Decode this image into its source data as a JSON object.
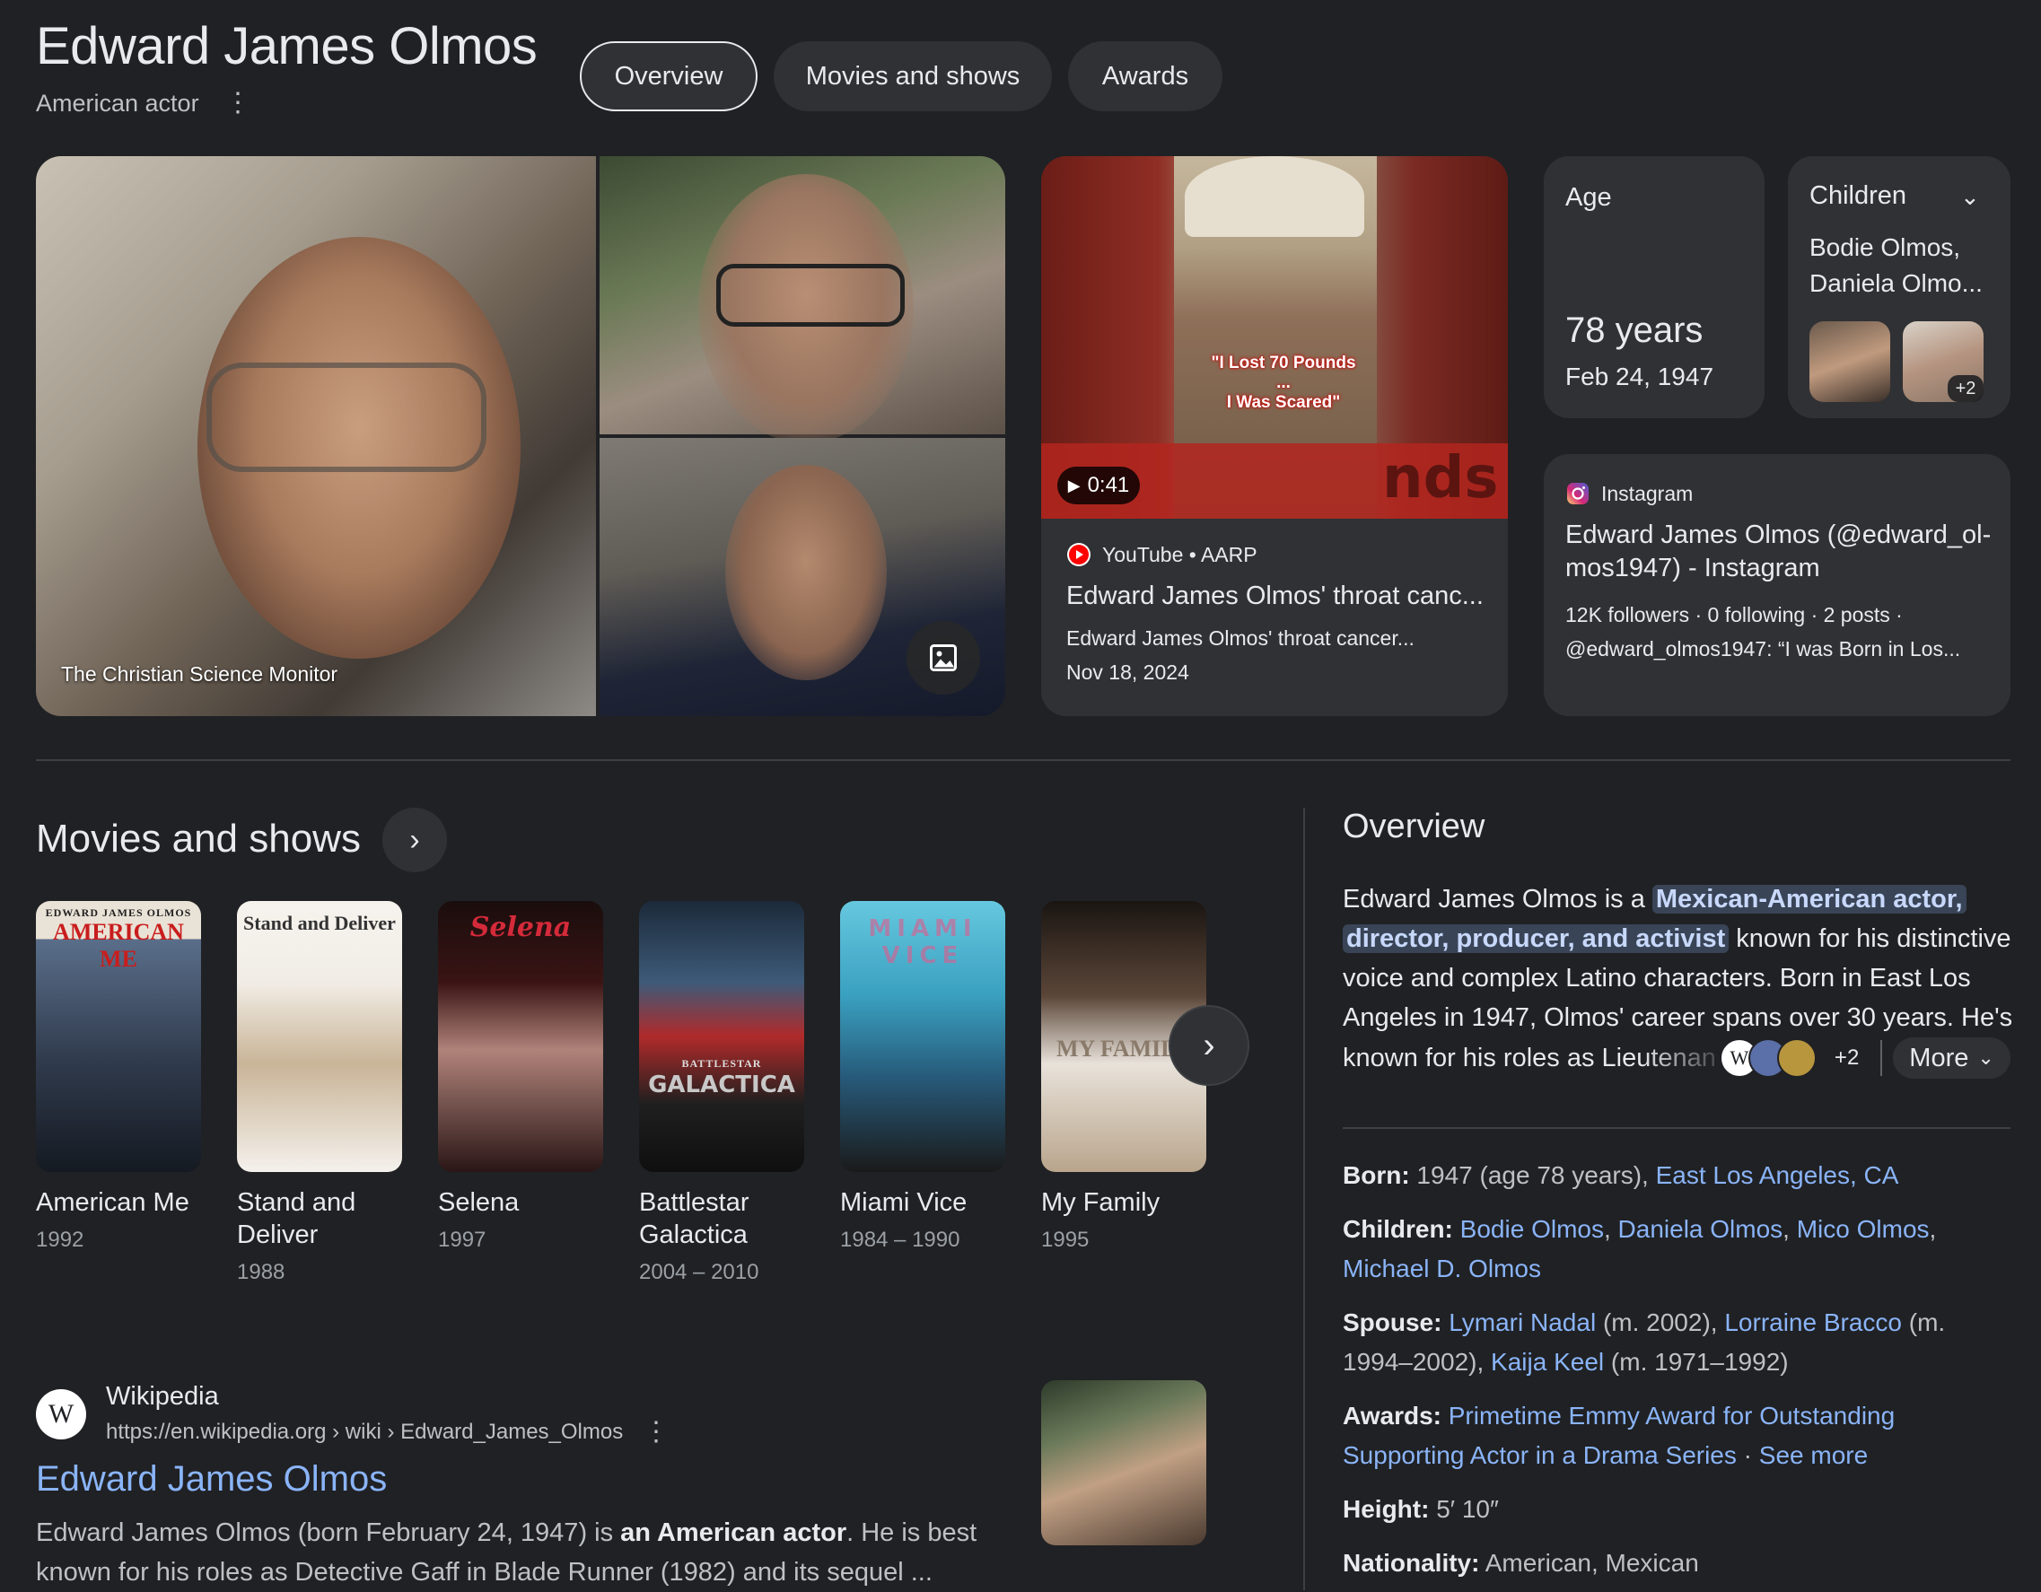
{
  "header": {
    "title": "Edward James Olmos",
    "subtitle": "American actor",
    "tabs": [
      {
        "label": "Overview",
        "active": true
      },
      {
        "label": "Movies and shows",
        "active": false
      },
      {
        "label": "Awards",
        "active": false
      }
    ]
  },
  "images": {
    "credit": "The Christian Science Monitor",
    "more_images_icon": "image-icon"
  },
  "video": {
    "duration": "0:41",
    "overlay_text_1": "\"I Lost 70 Pounds ...",
    "overlay_text_2": "I Was Scared\"",
    "banner_text": "nds",
    "source": "YouTube • AARP",
    "title": "Edward James Olmos' throat canc...",
    "snippet": "Edward James Olmos' throat cancer...",
    "date": "Nov 18, 2024"
  },
  "age": {
    "label": "Age",
    "value": "78 years",
    "date": "Feb 24, 1947"
  },
  "children": {
    "label": "Children",
    "names_line1": "Bodie Olmos,",
    "names_line2": "Daniela Olmo...",
    "more_count": "+2"
  },
  "instagram": {
    "source": "Instagram",
    "title_line1": "Edward James Olmos (@edward_ol-",
    "title_line2": "mos1947) - Instagram",
    "stats": "12K followers · 0 following · 2 posts ·",
    "snippet": "@edward_olmos1947: “I was Born in Los..."
  },
  "movies": {
    "section_title": "Movies and shows",
    "items": [
      {
        "title_line1": "American Me",
        "title_line2": "",
        "year": "1992",
        "poster_text": "AMERICAN ME",
        "poster_top": "EDWARD JAMES OLMOS"
      },
      {
        "title_line1": "Stand and",
        "title_line2": "Deliver",
        "year": "1988",
        "poster_text": "Stand and Deliver",
        "poster_top": ""
      },
      {
        "title_line1": "Selena",
        "title_line2": "",
        "year": "1997",
        "poster_text": "Selena",
        "poster_top": ""
      },
      {
        "title_line1": "Battlestar",
        "title_line2": "Galactica",
        "year": "2004 – 2010",
        "poster_text": "GALACTICA",
        "poster_top": "BATTLESTAR"
      },
      {
        "title_line1": "Miami Vice",
        "title_line2": "",
        "year": "1984 – 1990",
        "poster_text": "MIAMI VICE",
        "poster_top": ""
      },
      {
        "title_line1": "My Family",
        "title_line2": "",
        "year": "1995",
        "poster_text": "MY FAMILY",
        "poster_top": ""
      }
    ]
  },
  "wikipedia": {
    "site": "Wikipedia",
    "url": "https://en.wikipedia.org › wiki › Edward_James_Olmos",
    "title": "Edward James Olmos",
    "snippet_pre": "Edward James Olmos (born February 24, 1947) is ",
    "snippet_bold": "an American actor",
    "snippet_post": ". He is best",
    "snippet_line2": "known for his roles as Detective Gaff in Blade Runner (1982) and its sequel ..."
  },
  "overview": {
    "heading": "Overview",
    "line1_pre": "Edward James Olmos is a ",
    "line1_hl": "Mexican-American actor,",
    "line2_hl": "director, producer, and activist",
    "line2_post": " known for his distinctive",
    "line3": "voice and complex Latino characters. Born in East Los",
    "line4": "Angeles in 1947, Olmos' career spans over 30 years. He's",
    "line5": "known for his roles as Lieutenan",
    "source_count": "+2",
    "more_label": "More",
    "facts": {
      "born_label": "Born:",
      "born_text": " 1947 (age 78 years), ",
      "born_link": "East Los Angeles, CA",
      "children_label": "Children:",
      "children_links": [
        "Bodie Olmos",
        "Daniela Olmos",
        "Mico Olmos",
        "Michael D. Olmos"
      ],
      "spouse_label": "Spouse:",
      "spouse_1": "Lymari Nadal",
      "spouse_1_years": " (m. 2002), ",
      "spouse_2": "Lorraine Bracco",
      "spouse_2_years_a": " (m.",
      "spouse_2_years_b": "1994–2002), ",
      "spouse_3": "Kaija Keel",
      "spouse_3_years": " (m. 1971–1992)",
      "awards_label": "Awards:",
      "awards_line1": "Primetime Emmy Award for Outstanding",
      "awards_line2": "Supporting Actor in a Drama Series",
      "awards_sep": " · ",
      "awards_more": "See more",
      "height_label": "Height:",
      "height_value": " 5′ 10″",
      "nationality_label": "Nationality:",
      "nationality_value": " American, Mexican"
    }
  },
  "colors": {
    "background": "#202124",
    "card": "#303134",
    "link": "#8ab4f8",
    "highlight": "#394457"
  }
}
